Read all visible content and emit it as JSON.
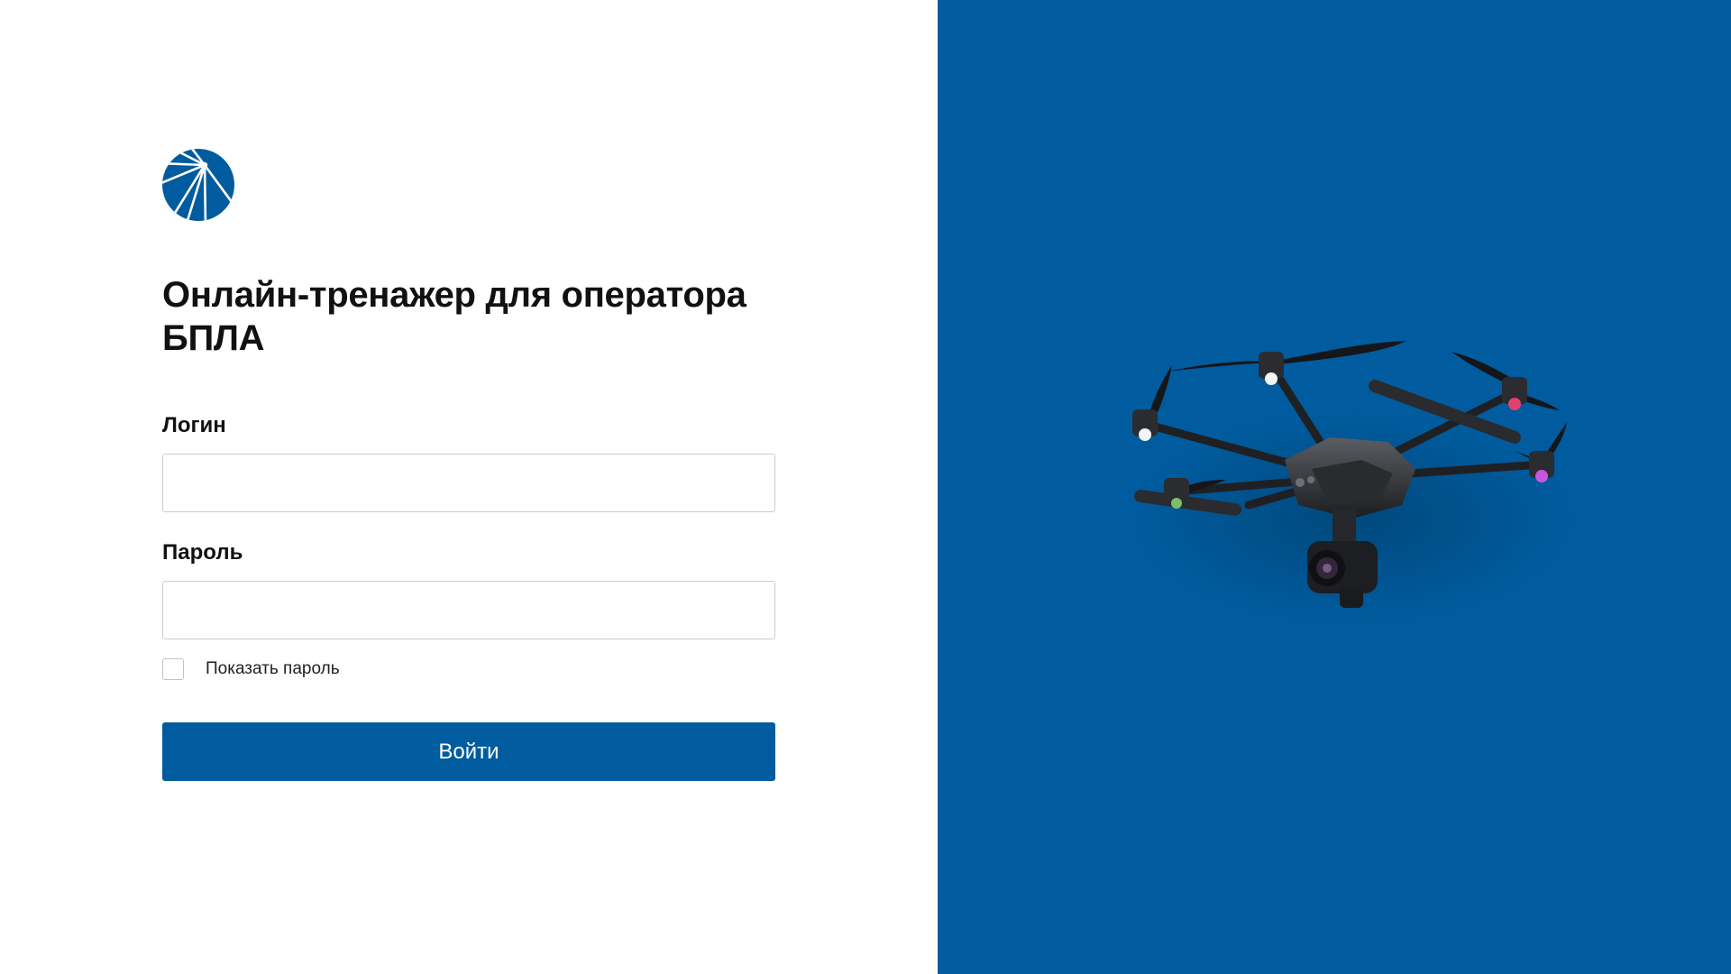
{
  "brand": {
    "logo_icon": "sun-rays-circle-logo-icon",
    "accent_color": "#005c9f"
  },
  "login": {
    "title": "Онлайн-тренажер для оператора БПЛА",
    "login_label": "Логин",
    "login_value": "",
    "password_label": "Пароль",
    "password_value": "",
    "show_password_label": "Показать пароль",
    "show_password_checked": false,
    "submit_label": "Войти"
  },
  "hero": {
    "background_color": "#005c9f",
    "image_icon": "hexacopter-drone-icon"
  }
}
